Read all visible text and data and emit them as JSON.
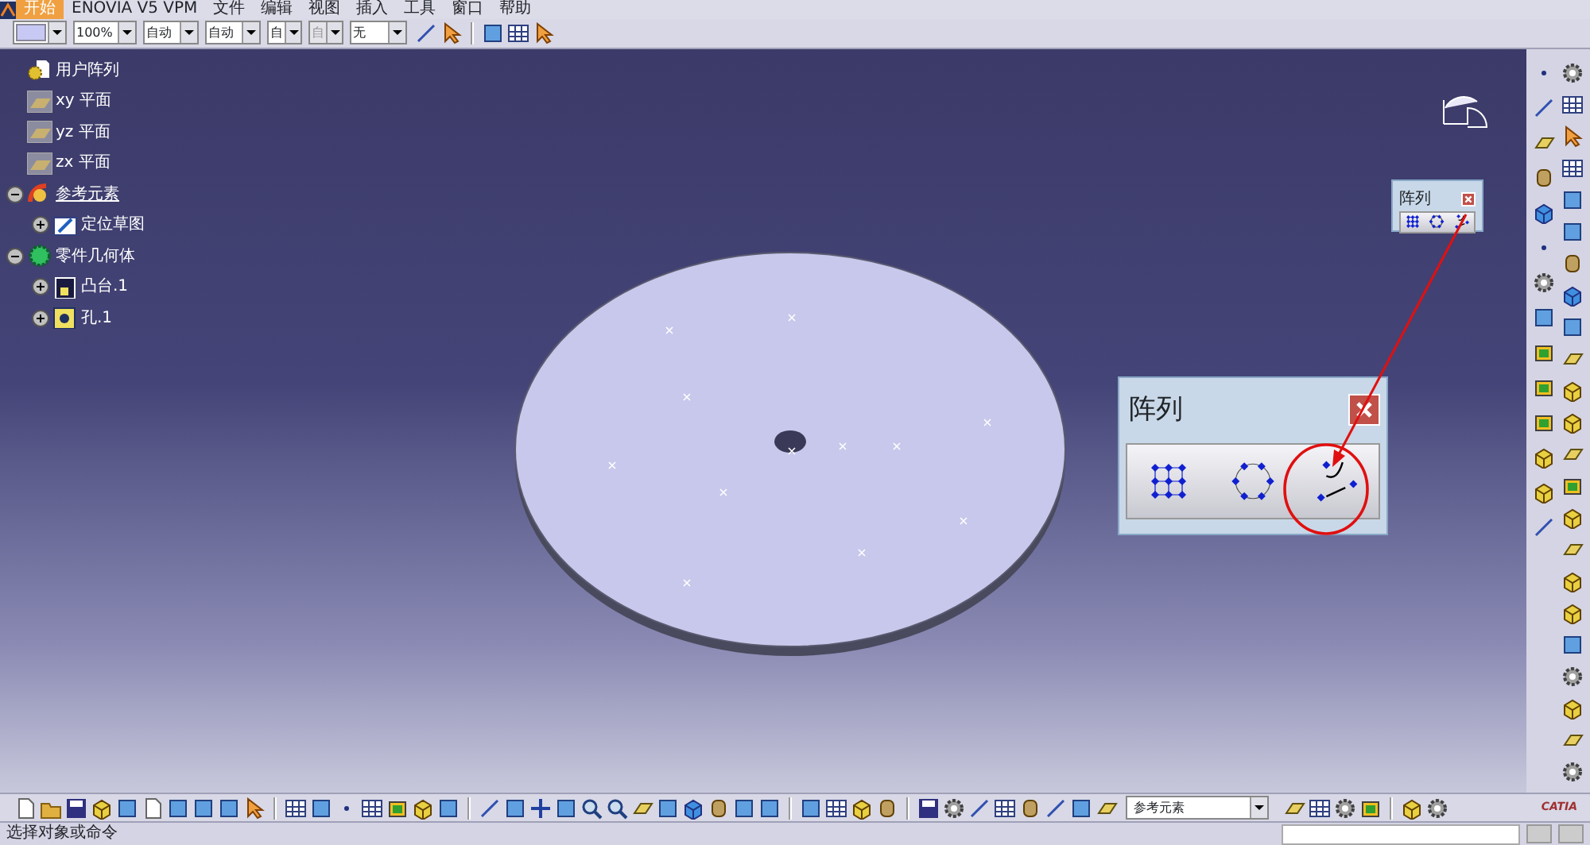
{
  "menu": [
    {
      "label": "开始",
      "selected": true
    },
    {
      "label": "ENOVIA V5 VPM",
      "selected": false
    },
    {
      "label": "文件",
      "selected": false
    },
    {
      "label": "编辑",
      "selected": false
    },
    {
      "label": "视图",
      "selected": false
    },
    {
      "label": "插入",
      "selected": false
    },
    {
      "label": "工具",
      "selected": false
    },
    {
      "label": "窗口",
      "selected": false
    },
    {
      "label": "帮助",
      "selected": false
    }
  ],
  "toolbar": {
    "combos": [
      {
        "kind": "color",
        "disabled": false
      },
      {
        "kind": "text",
        "value": "100%",
        "disabled": false
      },
      {
        "kind": "text",
        "value": "自动",
        "disabled": false
      },
      {
        "kind": "text",
        "value": "自动",
        "disabled": false
      },
      {
        "kind": "text",
        "value": "自",
        "disabled": false
      },
      {
        "kind": "text",
        "value": "自",
        "disabled": true
      },
      {
        "kind": "text",
        "value": "无",
        "disabled": false
      }
    ]
  },
  "tree": {
    "label": "用户阵列",
    "kind": "part",
    "current": false,
    "children": [
      {
        "label": "xy 平面",
        "kind": "plane",
        "current": false
      },
      {
        "label": "yz 平面",
        "kind": "plane",
        "current": false
      },
      {
        "label": "zx 平面",
        "kind": "plane",
        "current": false
      },
      {
        "label": "参考元素",
        "kind": "geoset",
        "current": true,
        "expanded": true,
        "children": [
          {
            "label": "定位草图",
            "kind": "sketch",
            "current": false,
            "expanded": false
          }
        ]
      },
      {
        "label": "零件几何体",
        "kind": "body",
        "current": false,
        "expanded": true,
        "children": [
          {
            "label": "凸台.1",
            "kind": "pad",
            "current": false,
            "expanded": false
          },
          {
            "label": "孔.1",
            "kind": "hole",
            "current": false,
            "expanded": false
          }
        ]
      }
    ]
  },
  "small_palette": {
    "title": "阵列"
  },
  "large_palette": {
    "title": "阵列"
  },
  "bottom_toolbar": {
    "combo": "参考元素",
    "logo": "CATIA"
  },
  "status_bar": {
    "message": "选择对象或命令"
  }
}
